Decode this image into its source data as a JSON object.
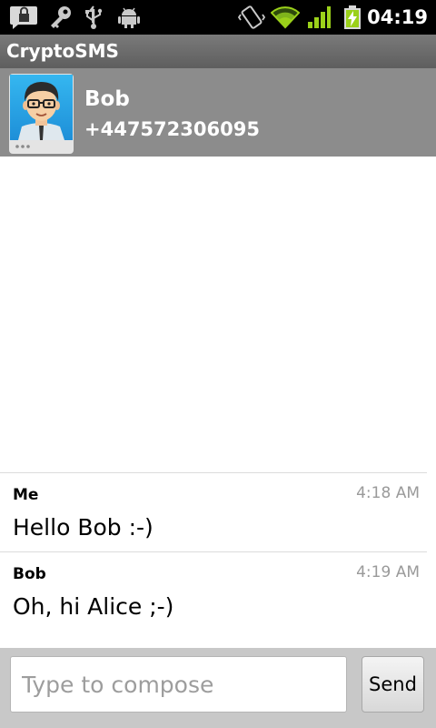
{
  "status_bar": {
    "time": "04:19",
    "icons": [
      "secure-notification-icon",
      "key-icon",
      "usb-icon",
      "android-debug-icon",
      "vibrate-icon",
      "wifi-icon",
      "signal-icon",
      "battery-charging-icon"
    ],
    "colors": {
      "background": "#000000",
      "accent": "#9bd11a"
    }
  },
  "app": {
    "title": "CryptoSMS"
  },
  "contact": {
    "name": "Bob",
    "number": "+447572306095"
  },
  "messages": [
    {
      "sender": "Me",
      "time": "4:18 AM",
      "body": "Hello Bob :-)"
    },
    {
      "sender": "Bob",
      "time": "4:19 AM",
      "body": "Oh, hi Alice ;-)"
    }
  ],
  "compose": {
    "placeholder": "Type to compose",
    "value": "",
    "send_label": "Send"
  }
}
